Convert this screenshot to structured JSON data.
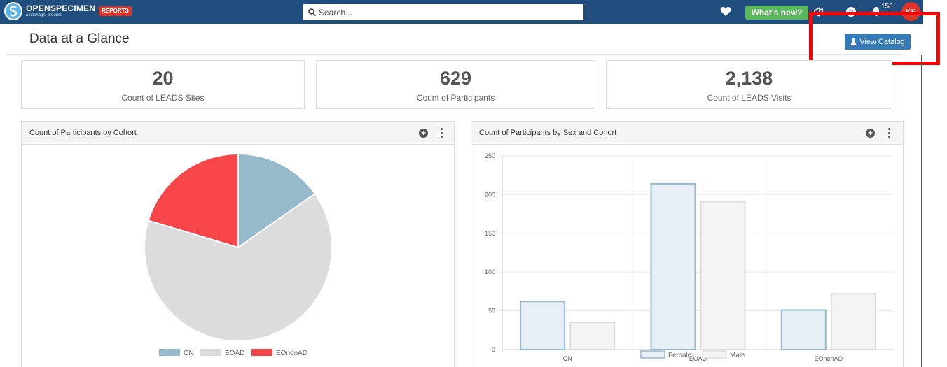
{
  "app": {
    "logo_main_bold": "OPEN",
    "logo_main_rest": "SPECIMEN",
    "logo_sub": "a krishagni product",
    "reports_badge": "REPORTS",
    "search_placeholder": "Search...",
    "whats_new_label": "What's new?",
    "notification_count": "158",
    "avatar_initials": "KE"
  },
  "page": {
    "title": "Data at a Glance",
    "view_catalog_label": "View Catalog"
  },
  "stats": [
    {
      "value": "20",
      "label": "Count of LEADS Sites"
    },
    {
      "value": "629",
      "label": "Count of Participants"
    },
    {
      "value": "2,138",
      "label": "Count of LEADS Visits"
    }
  ],
  "panels": {
    "cohort_title": "Count of Participants by Cohort",
    "sex_cohort_title": "Count of Participants by Sex and Cohort"
  },
  "chart_data": [
    {
      "type": "pie",
      "title": "Count of Participants by Cohort",
      "categories": [
        "CN",
        "EOAD",
        "EOnonAD"
      ],
      "values": [
        96,
        405,
        128
      ],
      "colors": [
        "#97b9cc",
        "#dcdcdc",
        "#f7464a"
      ],
      "legend": "bottom"
    },
    {
      "type": "bar",
      "title": "Count of Participants by Sex and Cohort",
      "categories": [
        "CN",
        "EOAD",
        "EOnonAD"
      ],
      "series": [
        {
          "name": "Female",
          "values": [
            62,
            214,
            51
          ],
          "fill": "#e8eef5",
          "stroke": "#97b9cc"
        },
        {
          "name": "Male",
          "values": [
            35,
            191,
            72
          ],
          "fill": "#f4f4f4",
          "stroke": "#dcdcdc"
        }
      ],
      "ylim": [
        0,
        250
      ],
      "yticks": [
        0,
        50,
        100,
        150,
        200,
        250
      ],
      "grid": true,
      "legend": "bottom"
    }
  ]
}
